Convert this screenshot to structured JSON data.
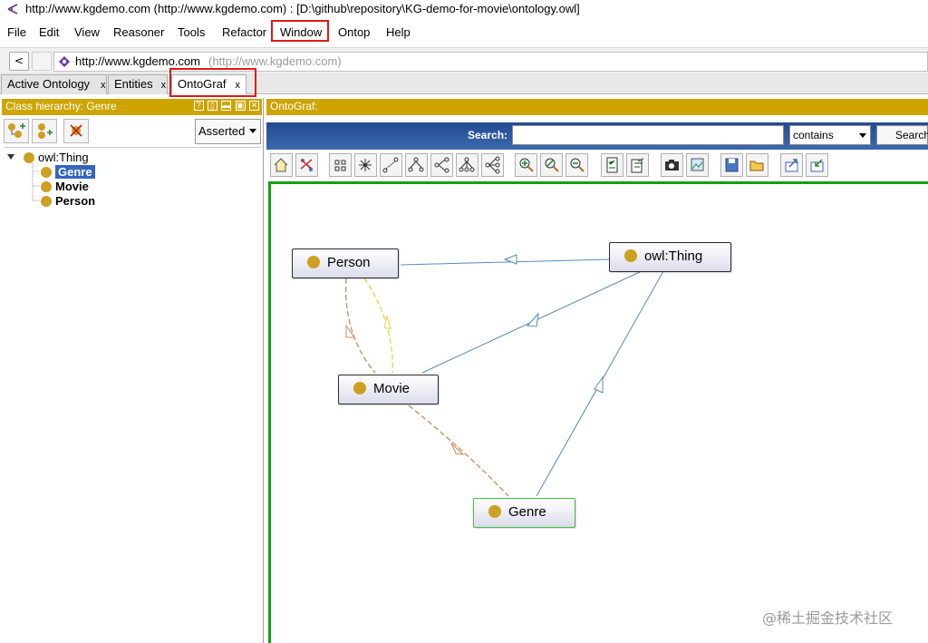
{
  "window": {
    "title": "http://www.kgdemo.com (http://www.kgdemo.com) : [D:\\github\\repository\\KG-demo-for-movie\\ontology.owl]"
  },
  "menu": {
    "file": "File",
    "edit": "Edit",
    "view": "View",
    "reasoner": "Reasoner",
    "tools": "Tools",
    "refactor": "Refactor",
    "window": "Window",
    "ontop": "Ontop",
    "help": "Help"
  },
  "address": {
    "back_label": "<",
    "url_main": "http://www.kgdemo.com",
    "url_sub": "(http://www.kgdemo.com)"
  },
  "tabs": [
    {
      "label": "Active Ontology",
      "close": "x"
    },
    {
      "label": "Entities",
      "close": "x"
    },
    {
      "label": "OntoGraf",
      "close": "x"
    }
  ],
  "left_panel": {
    "header": "Class hierarchy: Genre",
    "header_icons": [
      "?",
      "▯",
      "▬",
      "▣",
      "✕"
    ],
    "asserted": "Asserted",
    "tree": {
      "root": "owl:Thing",
      "children": [
        "Genre",
        "Movie",
        "Person"
      ],
      "selected": "Genre"
    }
  },
  "right_panel": {
    "header": "OntoGraf:",
    "search_label": "Search:",
    "search_value": "",
    "match_mode": "contains",
    "search_button": "Search"
  },
  "graph": {
    "nodes": {
      "person": "Person",
      "owl_thing": "owl:Thing",
      "movie": "Movie",
      "genre": "Genre"
    },
    "highlighted_node": "Genre"
  },
  "watermark": "@稀土掘金技术社区",
  "colors": {
    "panel_header": "#cda400",
    "class_dot": "#cca023",
    "selection": "#3466c0",
    "subclass_edge": "#5a88b8",
    "property_edge_1": "#d08a50",
    "property_edge_2": "#e8d040",
    "canvas_border": "#14a014",
    "callout": "#e01818"
  }
}
